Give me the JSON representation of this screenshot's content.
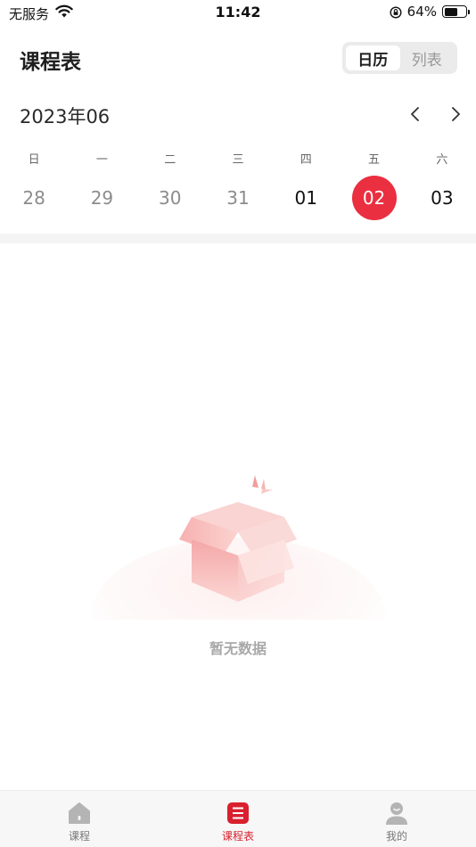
{
  "status_bar": {
    "carrier": "无服务",
    "time": "11:42",
    "battery_percent_text": "64%",
    "battery_level": 0.64
  },
  "header": {
    "title": "课程表",
    "toggle": {
      "calendar": "日历",
      "list": "列表",
      "active": "calendar"
    }
  },
  "calendar": {
    "month_label": "2023年06",
    "weekdays": [
      "日",
      "一",
      "二",
      "三",
      "四",
      "五",
      "六"
    ],
    "dates": [
      {
        "day": "28",
        "state": "muted"
      },
      {
        "day": "29",
        "state": "muted"
      },
      {
        "day": "30",
        "state": "muted"
      },
      {
        "day": "31",
        "state": "muted"
      },
      {
        "day": "01",
        "state": "normal"
      },
      {
        "day": "02",
        "state": "selected"
      },
      {
        "day": "03",
        "state": "normal"
      }
    ],
    "selected_color": "#ea2f40"
  },
  "empty_state": {
    "text": "暂无数据"
  },
  "tab_bar": {
    "items": [
      {
        "label": "课程",
        "icon": "home-icon"
      },
      {
        "label": "课程表",
        "icon": "schedule-icon"
      },
      {
        "label": "我的",
        "icon": "profile-icon"
      }
    ],
    "active_index": 1,
    "accent_color": "#d9202f"
  }
}
